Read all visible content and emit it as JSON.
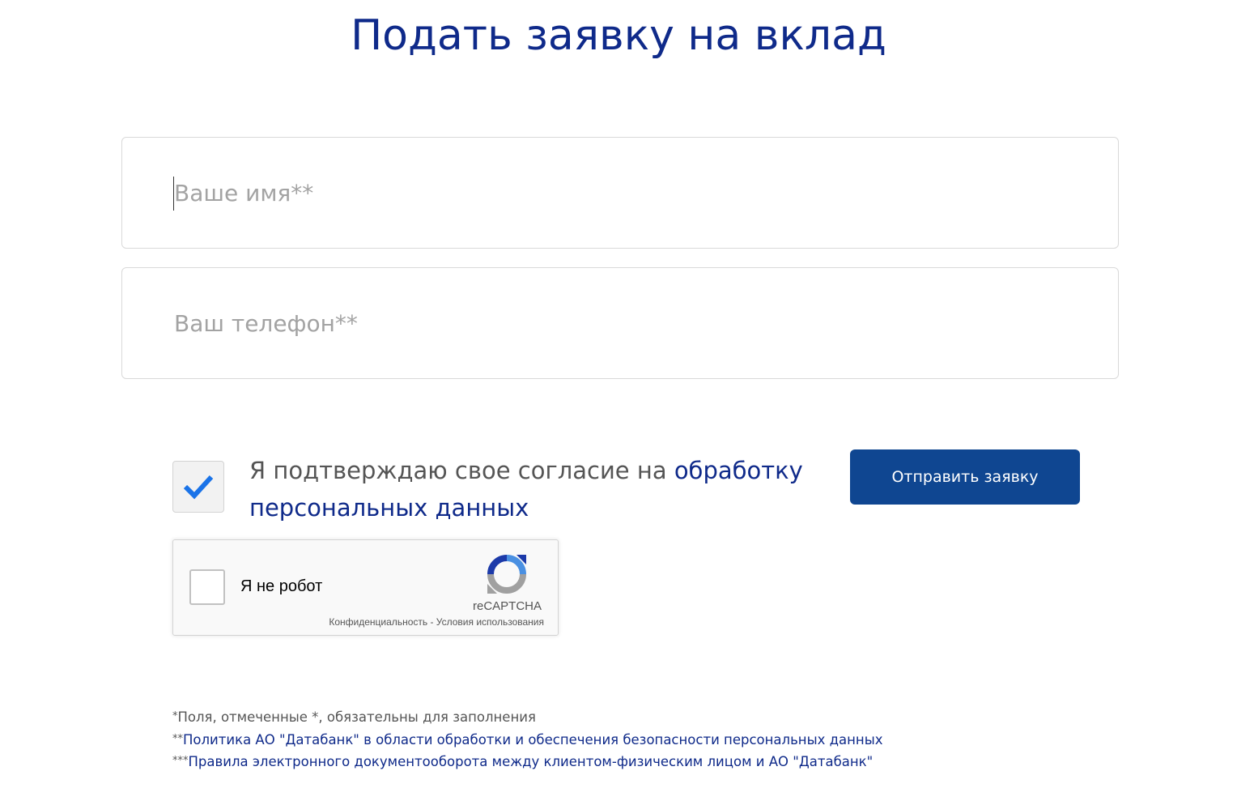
{
  "header": {
    "title": "Подать заявку на вклад"
  },
  "form": {
    "name_placeholder": "Ваше имя**",
    "name_value": "",
    "phone_placeholder": "Ваш телефон**",
    "phone_value": "",
    "consent_checked": true,
    "consent_text": "Я подтверждаю свое согласие на ",
    "consent_link": "обработку персональных данных",
    "submit_label": "Отправить заявку"
  },
  "recaptcha": {
    "label": "Я не робот",
    "brand": "reCAPTCHA",
    "privacy_link": "Конфиденциальность",
    "separator": " - ",
    "terms_link": "Условия использования"
  },
  "footnotes": {
    "required_mark": "*",
    "required_text": "Поля, отмеченные *, обязательны для заполнения",
    "policy_mark": "**",
    "policy_link": "Политика АО \"Датабанк\" в области обработки и обеспечения безопасности персональных данных",
    "edo_mark": "***",
    "edo_link": "Правила электронного документооборота между клиентом-физическим лицом и АО \"Датабанк\""
  },
  "colors": {
    "brand_dark": "#0f2a8a",
    "button": "#0f4691",
    "check": "#1a73e8"
  },
  "icons": {
    "consent": "checkmark-icon",
    "recaptcha": "recaptcha-logo-icon"
  }
}
